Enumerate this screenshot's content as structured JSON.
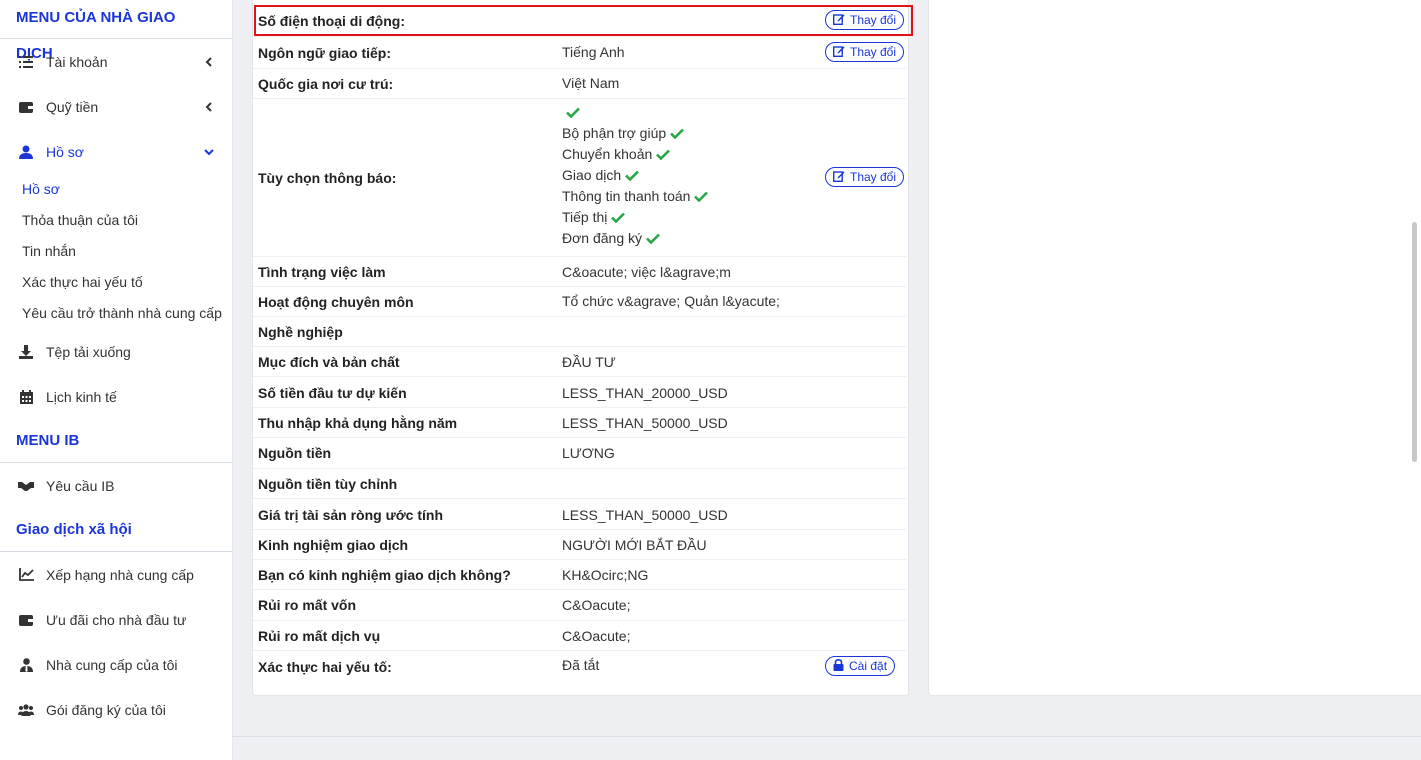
{
  "sidebar": {
    "trader_menu_title": "MENU CỦA NHÀ GIAO DỊCH",
    "items": [
      {
        "label": "Tài khoản"
      },
      {
        "label": "Quỹ tiền"
      },
      {
        "label": "Hồ sơ"
      }
    ],
    "sub_items": [
      {
        "label": "Hồ sơ"
      },
      {
        "label": "Thỏa thuận của tôi"
      },
      {
        "label": "Tin nhắn"
      },
      {
        "label": "Xác thực hai yếu tố"
      },
      {
        "label": "Yêu cầu trở thành nhà cung cấp"
      }
    ],
    "items2": [
      {
        "label": "Tệp tải xuống"
      },
      {
        "label": "Lịch kinh tế"
      }
    ],
    "ib_menu_title": "MENU IB",
    "ib_items": [
      {
        "label": "Yêu cầu IB"
      }
    ],
    "social_title": "Giao dịch xã hội",
    "social_items": [
      {
        "label": "Xếp hạng nhà cung cấp"
      },
      {
        "label": "Ưu đãi cho nhà đầu tư"
      },
      {
        "label": "Nhà cung cấp của tôi"
      },
      {
        "label": "Gói đăng ký của tôi"
      }
    ]
  },
  "profile": {
    "change_label": "Thay đổi",
    "setup_label": "Cài đặt",
    "rows": [
      {
        "key": "Số điện thoại di động:",
        "value": ""
      },
      {
        "key": "Ngôn ngữ giao tiếp:",
        "value": "Tiếng Anh"
      },
      {
        "key": "Quốc gia nơi cư trú:",
        "value": "Việt Nam"
      },
      {
        "key": "Tùy chọn thông báo:",
        "value": ""
      },
      {
        "key": "Tình trạng việc làm",
        "value": "C&oacute; việc l&agrave;m"
      },
      {
        "key": "Hoạt động chuyên môn",
        "value": "Tổ chức v&agrave; Quản l&yacute;"
      },
      {
        "key": "Nghề nghiệp",
        "value": ""
      },
      {
        "key": "Mục đích và bản chất",
        "value": "ĐẦU TƯ"
      },
      {
        "key": "Số tiền đầu tư dự kiến",
        "value": "LESS_THAN_20000_USD"
      },
      {
        "key": "Thu nhập khả dụng hằng năm",
        "value": "LESS_THAN_50000_USD"
      },
      {
        "key": "Nguồn tiền",
        "value": "LƯƠNG"
      },
      {
        "key": "Nguồn tiền tùy chỉnh",
        "value": ""
      },
      {
        "key": "Giá trị tài sản ròng ước tính",
        "value": "LESS_THAN_50000_USD"
      },
      {
        "key": "Kinh nghiệm giao dịch",
        "value": "NGƯỜI MỚI BẮT ĐẦU"
      },
      {
        "key": "Bạn có kinh nghiệm giao dịch không?",
        "value": "KH&Ocirc;NG"
      },
      {
        "key": "Rủi ro mất vốn",
        "value": "C&Oacute;"
      },
      {
        "key": "Rủi ro mất dịch vụ",
        "value": "C&Oacute;"
      },
      {
        "key": "Xác thực hai yếu tố:",
        "value": "Đã tắt"
      }
    ],
    "notifications": [
      {
        "label": ""
      },
      {
        "label": "Bộ phận trợ giúp"
      },
      {
        "label": "Chuyển khoản"
      },
      {
        "label": "Giao dịch"
      },
      {
        "label": "Thông tin thanh toán"
      },
      {
        "label": "Tiếp thị"
      },
      {
        "label": "Đơn đăng ký"
      }
    ]
  },
  "colors": {
    "accent": "#1a35d8",
    "check": "#28a745",
    "highlight": "#e01414"
  }
}
